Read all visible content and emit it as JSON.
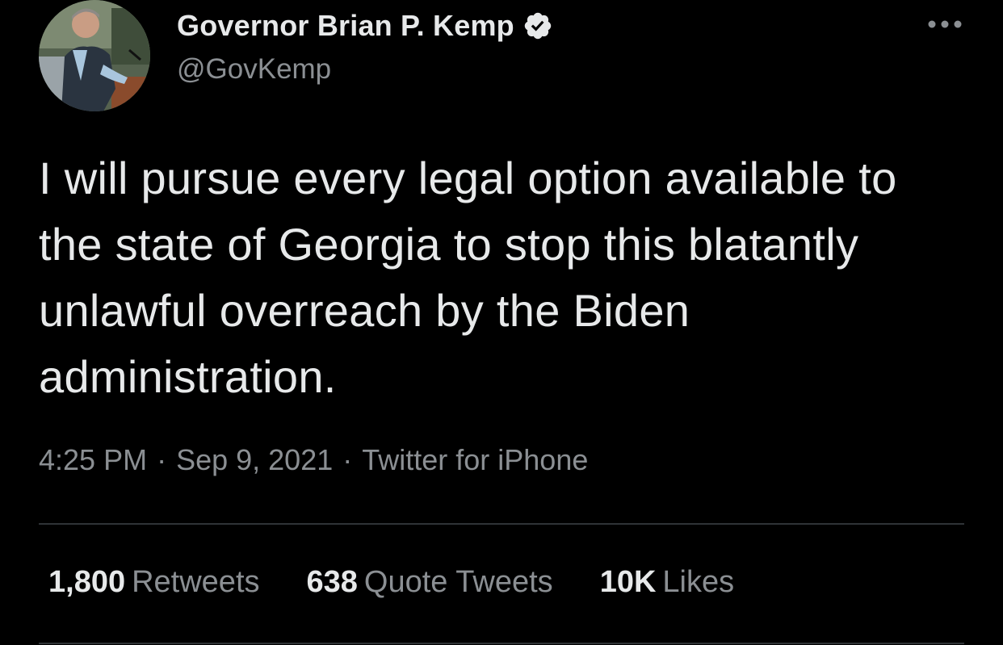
{
  "author": {
    "display_name": "Governor Brian P. Kemp",
    "handle": "@GovKemp",
    "verified": true
  },
  "tweet": {
    "text": "I will pursue every legal option available to the state of Georgia to stop this blatantly unlawful overreach by the Biden administration.",
    "time": "4:25 PM",
    "date": "Sep 9, 2021",
    "source": "Twitter for iPhone",
    "separator": "·"
  },
  "stats": {
    "retweets": {
      "count": "1,800",
      "label": "Retweets"
    },
    "quote_tweets": {
      "count": "638",
      "label": "Quote Tweets"
    },
    "likes": {
      "count": "10K",
      "label": "Likes"
    }
  },
  "icons": {
    "verified": "verified-badge-icon",
    "more": "more-options-icon"
  },
  "colors": {
    "background": "#000000",
    "primary_text": "#e7e9ea",
    "secondary_text": "#8b8f93",
    "divider": "#2f3336"
  }
}
